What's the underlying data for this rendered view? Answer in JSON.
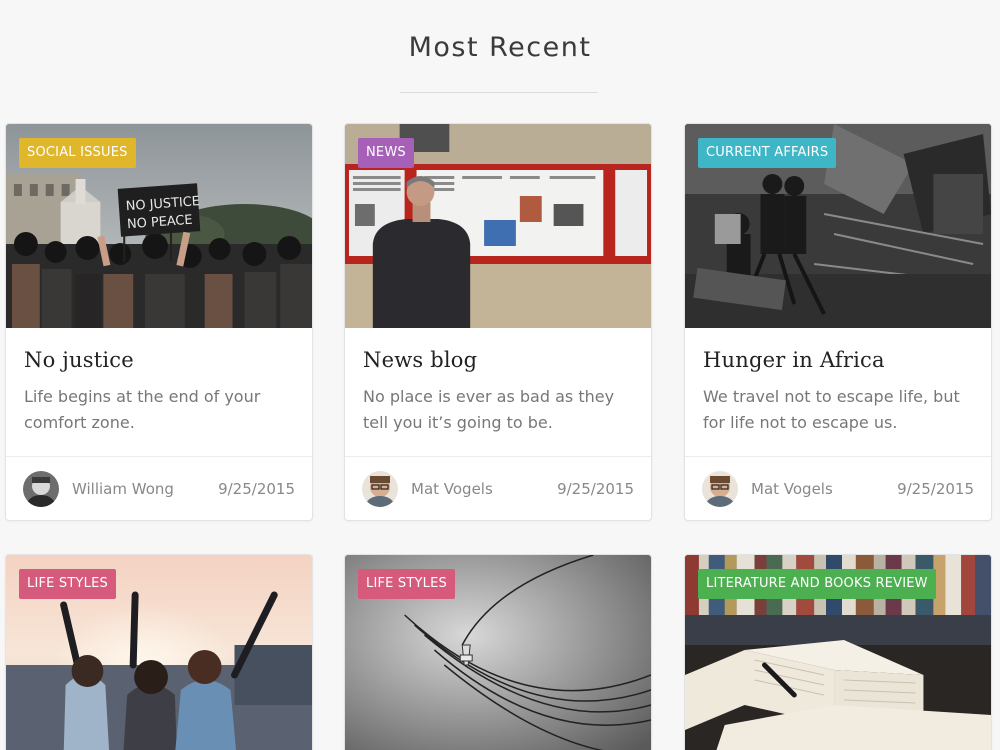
{
  "section": {
    "title": "Most Recent"
  },
  "colors": {
    "social_issues": "#e0b62a",
    "news": "#a660b8",
    "current_affairs": "#3fb6c6",
    "life_styles": "#d65a7c",
    "literature": "#4caf50"
  },
  "cards": [
    {
      "category": "SOCIAL ISSUES",
      "title": "No justice",
      "excerpt": "Life begins at the end of your comfort zone.",
      "author": "William Wong",
      "date": "9/25/2015",
      "image": "protest-crowd-photo",
      "protest_sign": [
        "NO JUSTICE",
        "NO PEACE"
      ]
    },
    {
      "category": "NEWS",
      "title": "News blog",
      "excerpt": "No place is ever as bad as they tell you it’s going to be.",
      "author": "Mat Vogels",
      "date": "9/25/2015",
      "image": "man-reading-newspaper-board-photo"
    },
    {
      "category": "CURRENT AFFAIRS",
      "title": "Hunger in Africa",
      "excerpt": "We travel not to escape life, but for life not to escape us.",
      "author": "Mat Vogels",
      "date": "9/25/2015",
      "image": "children-in-rubble-photo"
    },
    {
      "category": "LIFE STYLES",
      "image": "friends-at-sunset-photo"
    },
    {
      "category": "LIFE STYLES",
      "image": "foggy-power-lines-photo"
    },
    {
      "category": "LITERATURE AND BOOKS REVIEW",
      "image": "open-book-with-pen-photo"
    }
  ]
}
